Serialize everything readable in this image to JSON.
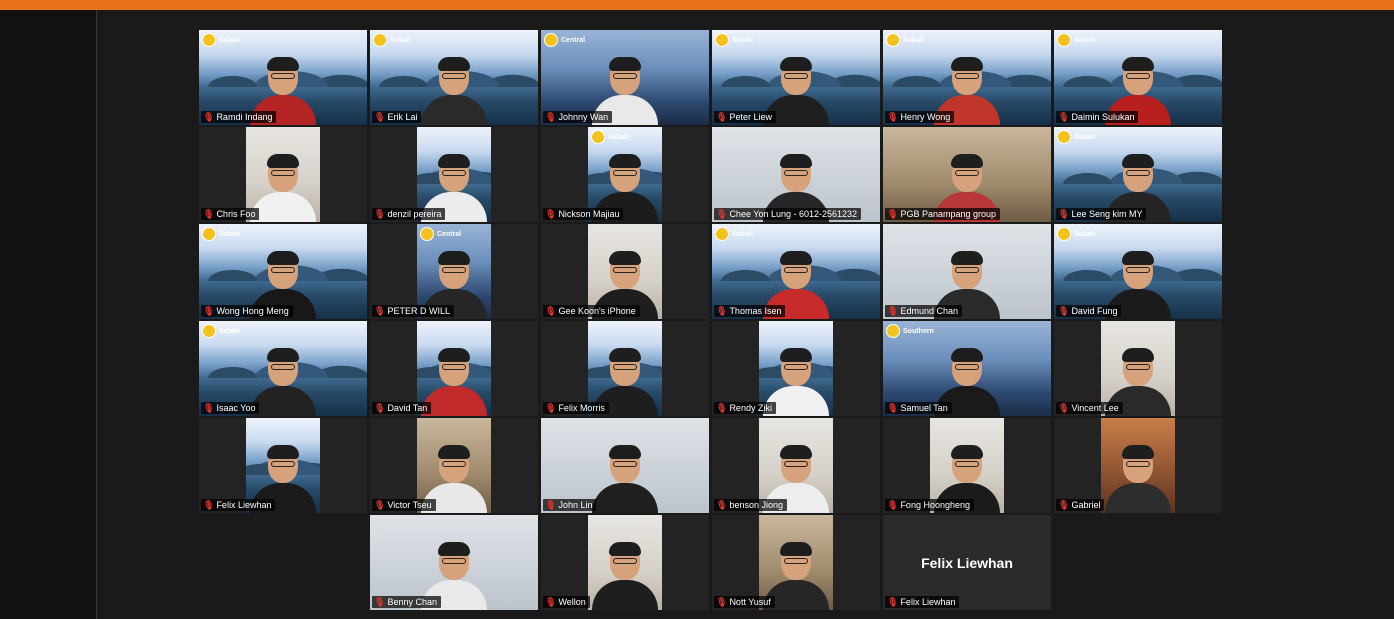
{
  "colors": {
    "top_bar": "#e8731a",
    "muted_mic": "#e5352c",
    "active_speaker": "#e2e25a"
  },
  "participants": [
    {
      "name": "Ramdi Indang",
      "bg": "mountain",
      "banner": "Sabah",
      "shirt": "#b52424"
    },
    {
      "name": "Erik Lai",
      "bg": "mountain",
      "banner": "Sabah",
      "shirt": "#2a2a2a"
    },
    {
      "name": "Johnny Wan",
      "bg": "city",
      "banner": "Central",
      "shirt": "#e9e9e9"
    },
    {
      "name": "Peter Liew",
      "bg": "mountain",
      "banner": "Sabah",
      "shirt": "#1f1f1f"
    },
    {
      "name": "Henry Wong",
      "bg": "mountain",
      "banner": "Sabah",
      "shirt": "#c0362b"
    },
    {
      "name": "Daimin Sulukan",
      "bg": "mountain",
      "banner": "Sabah",
      "shirt": "#b82020"
    },
    {
      "name": "Chris Foo",
      "bg": "room",
      "narrow": true,
      "shirt": "#f1f1f1"
    },
    {
      "name": "denzil pereira",
      "bg": "mountain",
      "narrow": true,
      "shirt": "#ececec"
    },
    {
      "name": "Nickson Majiau",
      "bg": "mountain",
      "narrow": true,
      "banner": "Sabah",
      "shirt": "#1c1c1c"
    },
    {
      "name": "Chee Yon Lung - 6012-2561232",
      "bg": "office",
      "shirt": "#272727"
    },
    {
      "name": "PGB Panampang group",
      "bg": "warm",
      "shirt": "#b83838"
    },
    {
      "name": "Lee Seng kim MY",
      "bg": "mountain",
      "banner": "Sabah",
      "shirt": "#252525"
    },
    {
      "name": "Wong Hong Meng",
      "bg": "mountain",
      "banner": "Sabah",
      "shirt": "#181818"
    },
    {
      "name": "PETER D WILL",
      "bg": "city",
      "narrow": true,
      "banner": "Central",
      "shirt": "#262626"
    },
    {
      "name": "Gee Koon's iPhone",
      "bg": "room",
      "narrow": true,
      "shirt": "#1e1e1e"
    },
    {
      "name": "Thomas Isen",
      "bg": "mountain",
      "banner": "Sabah",
      "shirt": "#c92b2b"
    },
    {
      "name": "Edmund Chan",
      "bg": "office",
      "shirt": "#2a2a2a"
    },
    {
      "name": "David Fung",
      "bg": "mountain",
      "banner": "Sabah",
      "shirt": "#1b1b1b",
      "active": true
    },
    {
      "name": "Isaac Yoo",
      "bg": "mountain",
      "banner": "Sabah",
      "shirt": "#222222"
    },
    {
      "name": "David Tan",
      "bg": "mountain",
      "narrow": true,
      "shirt": "#c02a2a"
    },
    {
      "name": "Felix Morris",
      "bg": "mountain",
      "narrow": true,
      "shirt": "#1e1e1e"
    },
    {
      "name": "Rendy Ziki",
      "bg": "mountain",
      "narrow": true,
      "shirt": "#f0f0f0"
    },
    {
      "name": "Samuel Tan",
      "bg": "city",
      "banner": "Southern",
      "shirt": "#1a1a1a"
    },
    {
      "name": "Vincent Lee",
      "bg": "room",
      "narrow": true,
      "shirt": "#2a2a2a"
    },
    {
      "name": "Felix Liewhan",
      "bg": "mountain",
      "narrow": true,
      "shirt": "#1a1a1a"
    },
    {
      "name": "Victor Tseu",
      "bg": "warm",
      "narrow": true,
      "shirt": "#e8e8e8"
    },
    {
      "name": "John Lin",
      "bg": "office",
      "shirt": "#1f1f1f"
    },
    {
      "name": "benson Jiong",
      "bg": "room",
      "narrow": true,
      "shirt": "#ededed"
    },
    {
      "name": "Fong Hoongheng",
      "bg": "room",
      "narrow": true,
      "shirt": "#1b1b1b"
    },
    {
      "name": "Gabriel",
      "bg": "orange",
      "narrow": true,
      "shirt": "#2d2d2d"
    },
    {
      "name": "Benny Chan",
      "bg": "office",
      "shirt": "#e9e9e9"
    },
    {
      "name": "Wellon",
      "bg": "room",
      "narrow": true,
      "shirt": "#1e1e1e"
    },
    {
      "name": "Nott Yusuf",
      "bg": "warm",
      "narrow": true,
      "shirt": "#262626"
    },
    {
      "name": "Felix Liewhan",
      "bg": "dark",
      "video_off": true,
      "big_label": "Felix Liewhan"
    }
  ]
}
